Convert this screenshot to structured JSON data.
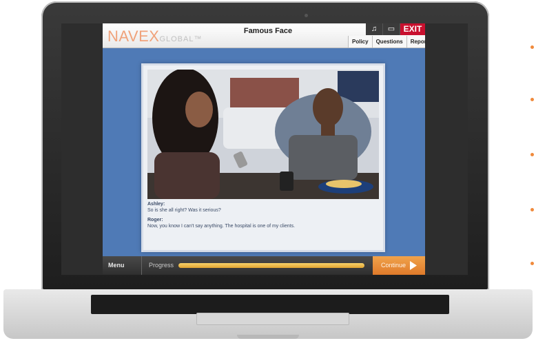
{
  "app": {
    "logo_main": "NAVEX",
    "logo_sub": "GLOBAL™",
    "title": "Famous Face",
    "icons": [
      "music-icon",
      "window-icon"
    ],
    "exit_label": "EXIT",
    "nav_tabs": [
      "Policy",
      "Questions",
      "Report"
    ]
  },
  "dialogue": [
    {
      "speaker": "Ashley:",
      "text": "So is she all right? Was it serious?"
    },
    {
      "speaker": "Roger:",
      "text": "Now, you know I can't say anything. The hospital is one of my clients."
    }
  ],
  "bottom_bar": {
    "menu_label": "Menu",
    "progress_label": "Progress",
    "progress_fraction": 1.0,
    "continue_label": "Continue"
  },
  "colors": {
    "accent_orange": "#f08a3c",
    "exit_red": "#c8102e",
    "app_blue": "#4f7ab6"
  }
}
